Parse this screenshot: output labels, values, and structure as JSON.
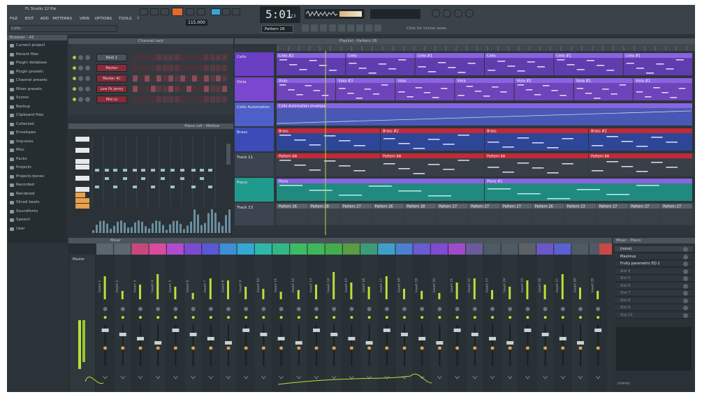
{
  "titlebar": {
    "title": "FL Studio 12 file",
    "hint": "Cello"
  },
  "menu": [
    "FILE",
    "EDIT",
    "ADD",
    "PATTERNS",
    "VIEW",
    "OPTIONS",
    "TOOLS",
    "?"
  ],
  "transport": {
    "time": "5:01",
    "time_sub": "23",
    "tempo": "115.000",
    "pattern": "Pattern 28",
    "news": "Click for online news"
  },
  "browser": {
    "title": "Browser - All",
    "items": [
      "Current project",
      "Recent files",
      "Plugin database",
      "Plugin presets",
      "Channel presets",
      "Mixer presets",
      "Scores",
      "Backup",
      "Clipboard files",
      "Collected",
      "Envelopes",
      "Impulses",
      "Misc",
      "Packs",
      "Projects",
      "Projects bones",
      "Recorded",
      "Rendered",
      "Sliced beats",
      "Soundfonts",
      "Speech",
      "User"
    ]
  },
  "channel_rack": {
    "title": "Channel rack",
    "channels": [
      "Beat 1",
      "Marker",
      "Marker 4C",
      "Low Pk Jenny",
      "Mid co"
    ]
  },
  "piano_roll": {
    "title": "Piano roll - Mellow"
  },
  "playlist": {
    "title": "Playlist - Pattern 26",
    "tracks": [
      {
        "name": "Cello",
        "color": "#6a3fc4",
        "clips": [
          "Cello #2",
          "Cello",
          "Cello #1",
          "Cello",
          "Cello #1",
          "Cello #1"
        ]
      },
      {
        "name": "Viola",
        "color": "#7b47d0",
        "clips": [
          "Viola",
          "Viola #3",
          "Viola",
          "Viola",
          "Viola #2",
          "Viola #1",
          "Viola #1"
        ]
      },
      {
        "name": "Cello Automation",
        "color": "#4f5fc8",
        "clips": [
          "Cello Automation envelope"
        ]
      },
      {
        "name": "Brass",
        "color": "#3b4cb8",
        "clips": [
          "Brass",
          "Brass #2",
          "Brass",
          "Brass #2"
        ]
      },
      {
        "name": "Track 11",
        "color": "#3b4450",
        "clips": [
          "Pattern 6A",
          "Pattern 6A",
          "Pattern 6A",
          "Pattern 6A"
        ]
      },
      {
        "name": "Piano",
        "color": "#1f9a8c",
        "clips": [
          "Piano",
          "Piano #1"
        ]
      },
      {
        "name": "Track 13",
        "color": "#3b4450",
        "clips": [
          "Pattern 26",
          "Pattern 28",
          "Pattern 27",
          "Pattern 26",
          "Pattern 28",
          "Pattern 27",
          "Pattern 27",
          "Pattern 27",
          "Pattern 26",
          "Pattern 23",
          "Pattern 27",
          "Pattern 27",
          "Pattern 27"
        ]
      }
    ]
  },
  "mixer": {
    "title": "Mixer",
    "insert_colors": [
      "#5b6770",
      "#5b6770",
      "#c9487a",
      "#d94b9c",
      "#b04bd1",
      "#7a4bd1",
      "#5a59d3",
      "#3f8fd6",
      "#34a8d4",
      "#2fb7a9",
      "#33b787",
      "#3dbb67",
      "#3fb65a",
      "#43ad4c",
      "#5a9c44",
      "#3c9c78",
      "#3f9fc8",
      "#4b7fd1",
      "#6a5bd3",
      "#7f4bd1",
      "#a04bc9",
      "#6a5b9a",
      "#4e5a64",
      "#4e5a64",
      "#5c6168",
      "#6a58c9",
      "#5a5fd1",
      "#4e5a64",
      "#4e5a64",
      "#c94848"
    ],
    "inserts": [
      "Master",
      "Insert 1",
      "Insert 2",
      "Insert 3",
      "Insert 4",
      "Insert 5",
      "Insert 6",
      "Insert 7",
      "Insert 8",
      "Insert 9",
      "Insert 10",
      "Insert 11",
      "Insert 12",
      "Insert 13",
      "Insert 14",
      "Insert 15",
      "Insert 16",
      "Insert 17",
      "Insert 18",
      "Insert 19",
      "Insert 20",
      "Insert 21",
      "Insert 22",
      "Insert 23",
      "Insert 24",
      "Insert 25",
      "Insert 26",
      "Insert 27",
      "Insert 28",
      "Insert 29"
    ],
    "levels": [
      0.8,
      0.55,
      0.2,
      0.35,
      0.6,
      0.3,
      0.15,
      0.5,
      0.45,
      0.3,
      0.25,
      0.18,
      0.22,
      0.35,
      0.65,
      0.4,
      0.3,
      0.55,
      0.25,
      0.2,
      0.15,
      0.4,
      0.5,
      0.22,
      0.3,
      0.45,
      0.35,
      0.6,
      0.28,
      0.2,
      0.5
    ]
  },
  "mixer_panel": {
    "title": "Mixer - Piano",
    "slots": [
      "(none)",
      "Maximus",
      "Fruity parametric EQ 2",
      "Slot 4",
      "Slot 5",
      "Slot 6",
      "Slot 7",
      "Slot 8",
      "Slot 9",
      "Slot 10"
    ],
    "footer": "(none)"
  }
}
